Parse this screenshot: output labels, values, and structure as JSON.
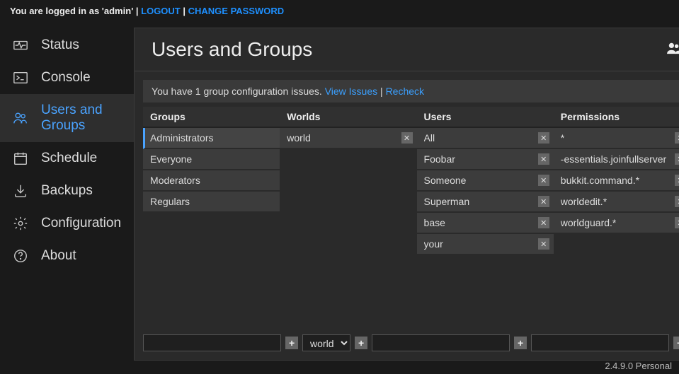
{
  "topbar": {
    "logged_in_prefix": "You are logged in as '",
    "username": "admin",
    "logged_in_suffix": "' | ",
    "logout": "LOGOUT",
    "sep": " | ",
    "change_password": "CHANGE PASSWORD"
  },
  "sidebar": {
    "items": [
      {
        "label": "Status",
        "icon": "heartbeat"
      },
      {
        "label": "Console",
        "icon": "terminal"
      },
      {
        "label": "Users and Groups",
        "icon": "users"
      },
      {
        "label": "Schedule",
        "icon": "calendar"
      },
      {
        "label": "Backups",
        "icon": "download"
      },
      {
        "label": "Configuration",
        "icon": "gear"
      },
      {
        "label": "About",
        "icon": "question"
      }
    ],
    "active_index": 2
  },
  "page": {
    "title": "Users and Groups",
    "header_icon": "users"
  },
  "notice": {
    "text": "You have 1 group configuration issues. ",
    "view": "View Issues",
    "sep": " | ",
    "recheck": "Recheck"
  },
  "columns": {
    "groups": {
      "header": "Groups",
      "selected_index": 0,
      "items": [
        "Administrators",
        "Everyone",
        "Moderators",
        "Regulars"
      ],
      "removable": false
    },
    "worlds": {
      "header": "Worlds",
      "selected_index": -1,
      "items": [
        "world"
      ],
      "removable": true
    },
    "users": {
      "header": "Users",
      "selected_index": -1,
      "items": [
        "All",
        "Foobar",
        "Someone",
        "Superman",
        "base",
        "your"
      ],
      "removable": true
    },
    "permissions": {
      "header": "Permissions",
      "selected_index": -1,
      "items": [
        "*",
        "-essentials.joinfullserver",
        "bukkit.command.*",
        "worldedit.*",
        "worldguard.*"
      ],
      "removable": true
    }
  },
  "footer": {
    "groups_value": "",
    "worlds_value": "world",
    "users_value": "",
    "permissions_value": ""
  },
  "version": "2.4.9.0 Personal"
}
